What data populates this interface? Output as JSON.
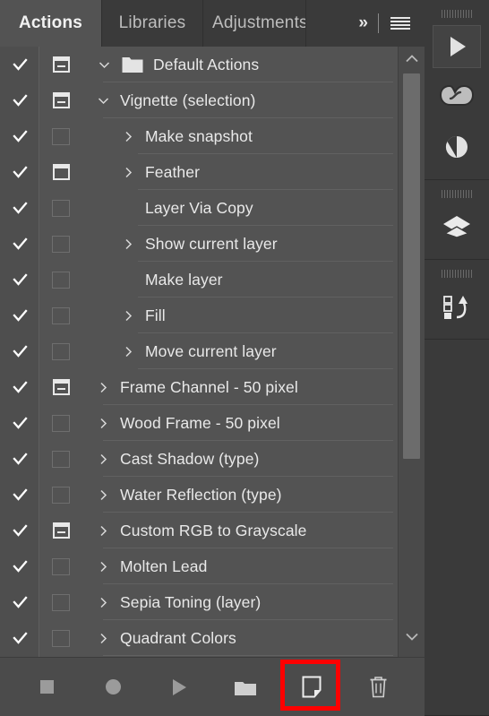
{
  "panel": {
    "tabs": [
      {
        "label": "Actions",
        "active": true
      },
      {
        "label": "Libraries",
        "active": false
      },
      {
        "label": "Adjustments",
        "active": false
      }
    ],
    "overflow_label": "»",
    "menu_icon": "hamburger-menu-icon"
  },
  "list": {
    "rows": [
      {
        "label": "Default Actions",
        "checked": true,
        "dialog": "minus",
        "twirl": "down",
        "kind": "set"
      },
      {
        "label": "Vignette (selection)",
        "checked": true,
        "dialog": "minus",
        "twirl": "down",
        "kind": "action"
      },
      {
        "label": "Make snapshot",
        "checked": true,
        "dialog": "empty",
        "twirl": "right",
        "kind": "step"
      },
      {
        "label": "Feather",
        "checked": true,
        "dialog": "bar",
        "twirl": "right",
        "kind": "step"
      },
      {
        "label": "Layer Via Copy",
        "checked": true,
        "dialog": "empty",
        "twirl": "none",
        "kind": "step"
      },
      {
        "label": "Show current layer",
        "checked": true,
        "dialog": "empty",
        "twirl": "right",
        "kind": "step"
      },
      {
        "label": "Make layer",
        "checked": true,
        "dialog": "empty",
        "twirl": "none",
        "kind": "step"
      },
      {
        "label": "Fill",
        "checked": true,
        "dialog": "empty",
        "twirl": "right",
        "kind": "step"
      },
      {
        "label": "Move current layer",
        "checked": true,
        "dialog": "empty",
        "twirl": "right",
        "kind": "step"
      },
      {
        "label": "Frame Channel - 50 pixel",
        "checked": true,
        "dialog": "minus",
        "twirl": "right",
        "kind": "action"
      },
      {
        "label": "Wood Frame - 50 pixel",
        "checked": true,
        "dialog": "empty",
        "twirl": "right",
        "kind": "action"
      },
      {
        "label": "Cast Shadow (type)",
        "checked": true,
        "dialog": "empty",
        "twirl": "right",
        "kind": "action"
      },
      {
        "label": "Water Reflection (type)",
        "checked": true,
        "dialog": "empty",
        "twirl": "right",
        "kind": "action"
      },
      {
        "label": "Custom RGB to Grayscale",
        "checked": true,
        "dialog": "minus",
        "twirl": "right",
        "kind": "action"
      },
      {
        "label": "Molten Lead",
        "checked": true,
        "dialog": "empty",
        "twirl": "right",
        "kind": "action"
      },
      {
        "label": "Sepia Toning (layer)",
        "checked": true,
        "dialog": "empty",
        "twirl": "right",
        "kind": "action"
      },
      {
        "label": "Quadrant Colors",
        "checked": true,
        "dialog": "empty",
        "twirl": "right",
        "kind": "action"
      }
    ]
  },
  "scrollbar": {
    "up_icon": "chevron-up-icon",
    "down_icon": "chevron-down-icon"
  },
  "toolbar": {
    "buttons": [
      {
        "name": "stop-playing-button",
        "icon": "stop-icon",
        "highlighted": false
      },
      {
        "name": "begin-recording-button",
        "icon": "record-icon",
        "highlighted": false
      },
      {
        "name": "play-selection-button",
        "icon": "play-icon",
        "highlighted": false
      },
      {
        "name": "create-new-set-button",
        "icon": "folder-icon",
        "highlighted": false
      },
      {
        "name": "create-new-action-button",
        "icon": "new-page-icon",
        "highlighted": true
      },
      {
        "name": "delete-button",
        "icon": "trash-icon",
        "highlighted": false
      }
    ],
    "highlight_color": "#fe0000"
  },
  "rail": {
    "groups": [
      {
        "items": [
          {
            "name": "rail-actions",
            "icon": "play-icon",
            "active": true
          },
          {
            "name": "rail-libraries",
            "icon": "creative-cloud-icon",
            "active": false
          },
          {
            "name": "rail-adjustments",
            "icon": "half-circle-icon",
            "active": false
          }
        ]
      },
      {
        "items": [
          {
            "name": "rail-layers",
            "icon": "layers-icon",
            "active": false
          }
        ]
      },
      {
        "items": [
          {
            "name": "rail-history",
            "icon": "history-icon",
            "active": false
          }
        ]
      }
    ]
  },
  "colors": {
    "panel_bg": "#535353",
    "tabbar_bg": "#3a3a3a",
    "toolbar_bg": "#4b4b4b",
    "text": "#e9e9e9",
    "rail_bg": "#3a3a3a"
  }
}
